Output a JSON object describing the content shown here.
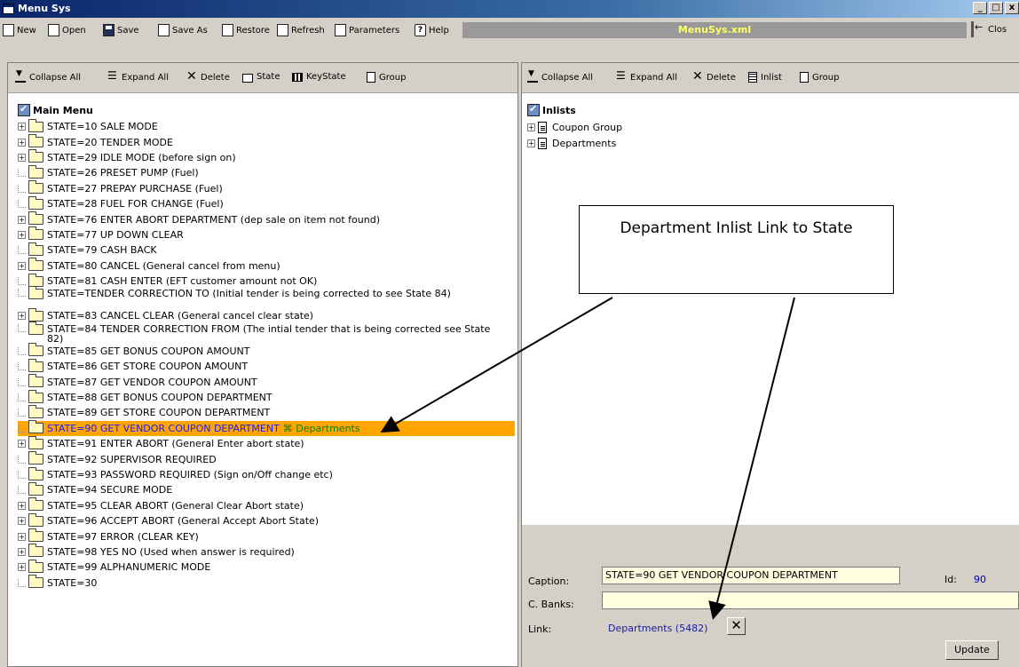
{
  "window": {
    "title": "Menu Sys",
    "buttons": [
      "_",
      "□",
      "x"
    ]
  },
  "toolbar": {
    "items": [
      {
        "label": "New",
        "icon": "new-file-icon"
      },
      {
        "label": "Open",
        "icon": "open-icon"
      },
      {
        "label": "Save",
        "icon": "save-icon"
      },
      {
        "label": "Save As",
        "icon": "save-as-icon"
      },
      {
        "label": "Restore",
        "icon": "restore-icon"
      },
      {
        "label": "Refresh",
        "icon": "refresh-icon"
      },
      {
        "label": "Parameters",
        "icon": "parameters-icon"
      },
      {
        "label": "Help",
        "icon": "help-icon"
      }
    ],
    "filename": "MenuSys.xml",
    "close_label": "Clos"
  },
  "left_tools": [
    "Collapse All",
    "Expand All",
    "Delete",
    "State",
    "KeyState",
    "Group"
  ],
  "right_tools": [
    "Collapse All",
    "Expand All",
    "Delete",
    "Inlist",
    "Group"
  ],
  "main_menu": {
    "title": "Main Menu",
    "items": [
      {
        "label": "STATE=10 SALE MODE",
        "expandable": true
      },
      {
        "label": "STATE=20 TENDER MODE",
        "expandable": true
      },
      {
        "label": "STATE=29 IDLE MODE (before sign on)",
        "expandable": true
      },
      {
        "label": "STATE=26 PRESET PUMP (Fuel)",
        "expandable": false
      },
      {
        "label": "STATE=27 PREPAY PURCHASE (Fuel)",
        "expandable": false
      },
      {
        "label": "STATE=28 FUEL FOR CHANGE (Fuel)",
        "expandable": false
      },
      {
        "label": "STATE=76 ENTER ABORT DEPARTMENT (dep sale on item not found)",
        "expandable": true
      },
      {
        "label": "STATE=77 UP DOWN CLEAR",
        "expandable": true
      },
      {
        "label": "STATE=79 CASH BACK",
        "expandable": false
      },
      {
        "label": "STATE=80 CANCEL (General cancel from menu)",
        "expandable": true
      },
      {
        "label": "STATE=81 CASH ENTER (EFT customer amount not OK)",
        "expandable": false
      },
      {
        "label": "STATE=TENDER CORRECTION TO (Initial tender is being corrected to see State 84)",
        "expandable": false,
        "tall": true
      },
      {
        "label": "STATE=83 CANCEL CLEAR (General cancel clear state)",
        "expandable": true
      },
      {
        "label": "STATE=84 TENDER CORRECTION FROM (The intial tender that is being corrected see State 82)",
        "expandable": false,
        "tall": true
      },
      {
        "label": "STATE=85 GET BONUS COUPON AMOUNT",
        "expandable": false
      },
      {
        "label": "STATE=86 GET STORE COUPON AMOUNT",
        "expandable": false
      },
      {
        "label": "STATE=87 GET VENDOR COUPON AMOUNT",
        "expandable": false
      },
      {
        "label": "STATE=88 GET BONUS COUPON DEPARTMENT",
        "expandable": false
      },
      {
        "label": "STATE=89 GET STORE COUPON DEPARTMENT",
        "expandable": false
      },
      {
        "label": "STATE=90 GET VENDOR COUPON DEPARTMENT",
        "expandable": false,
        "selected": true,
        "link": "Departments"
      },
      {
        "label": "STATE=91 ENTER ABORT (General Enter abort state)",
        "expandable": true
      },
      {
        "label": "STATE=92 SUPERVISOR REQUIRED",
        "expandable": false
      },
      {
        "label": "STATE=93 PASSWORD REQUIRED (Sign on/Off change etc)",
        "expandable": false
      },
      {
        "label": "STATE=94 SECURE MODE",
        "expandable": false
      },
      {
        "label": "STATE=95 CLEAR ABORT (General Clear Abort state)",
        "expandable": true
      },
      {
        "label": "STATE=96 ACCEPT ABORT (General Accept Abort State)",
        "expandable": true
      },
      {
        "label": "STATE=97 ERROR (CLEAR KEY)",
        "expandable": true
      },
      {
        "label": "STATE=98 YES NO (Used when answer is required)",
        "expandable": true
      },
      {
        "label": "STATE=99 ALPHANUMERIC MODE",
        "expandable": true
      },
      {
        "label": "STATE=30",
        "expandable": false
      }
    ]
  },
  "inlists": {
    "title": "Inlists",
    "items": [
      {
        "label": "Coupon Group"
      },
      {
        "label": "Departments"
      }
    ]
  },
  "properties": {
    "caption_label": "Caption:",
    "caption_value": "STATE=90 GET VENDOR COUPON DEPARTMENT",
    "id_label": "Id:",
    "id_value": "90",
    "cbanks_label": "C. Banks:",
    "cbanks_value": "",
    "link_label": "Link:",
    "link_value": "Departments (5482)",
    "update_label": "Update"
  },
  "callout": {
    "text": "Department Inlist Link to State"
  }
}
